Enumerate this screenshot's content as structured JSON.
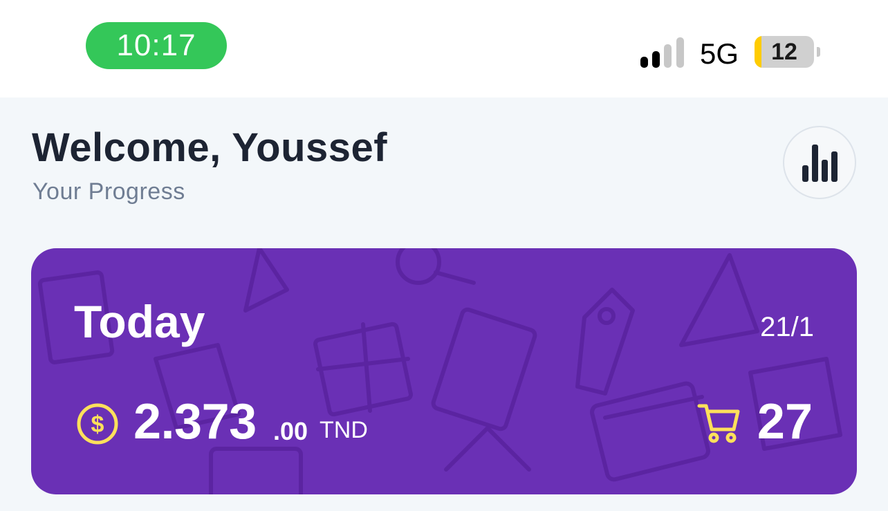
{
  "status_bar": {
    "time": "10:17",
    "network": "5G",
    "battery": "12",
    "battery_level": 0.12,
    "signal_bars_active": 2,
    "colors": {
      "time_pill": "#34c759",
      "battery_fill": "#ffcc00"
    }
  },
  "header": {
    "title": "Welcome, Youssef",
    "subtitle": "Your Progress",
    "stats_icon": "bar-chart-icon"
  },
  "summary_card": {
    "title": "Today",
    "date": "21/1",
    "amount_integer": "2.373",
    "amount_decimal": ".00",
    "currency": "TND",
    "amount_icon": "dollar-coin-icon",
    "cart_icon": "shopping-cart-icon",
    "cart_count": "27",
    "colors": {
      "background": "#6a30b5",
      "accent": "#fde05b"
    }
  }
}
